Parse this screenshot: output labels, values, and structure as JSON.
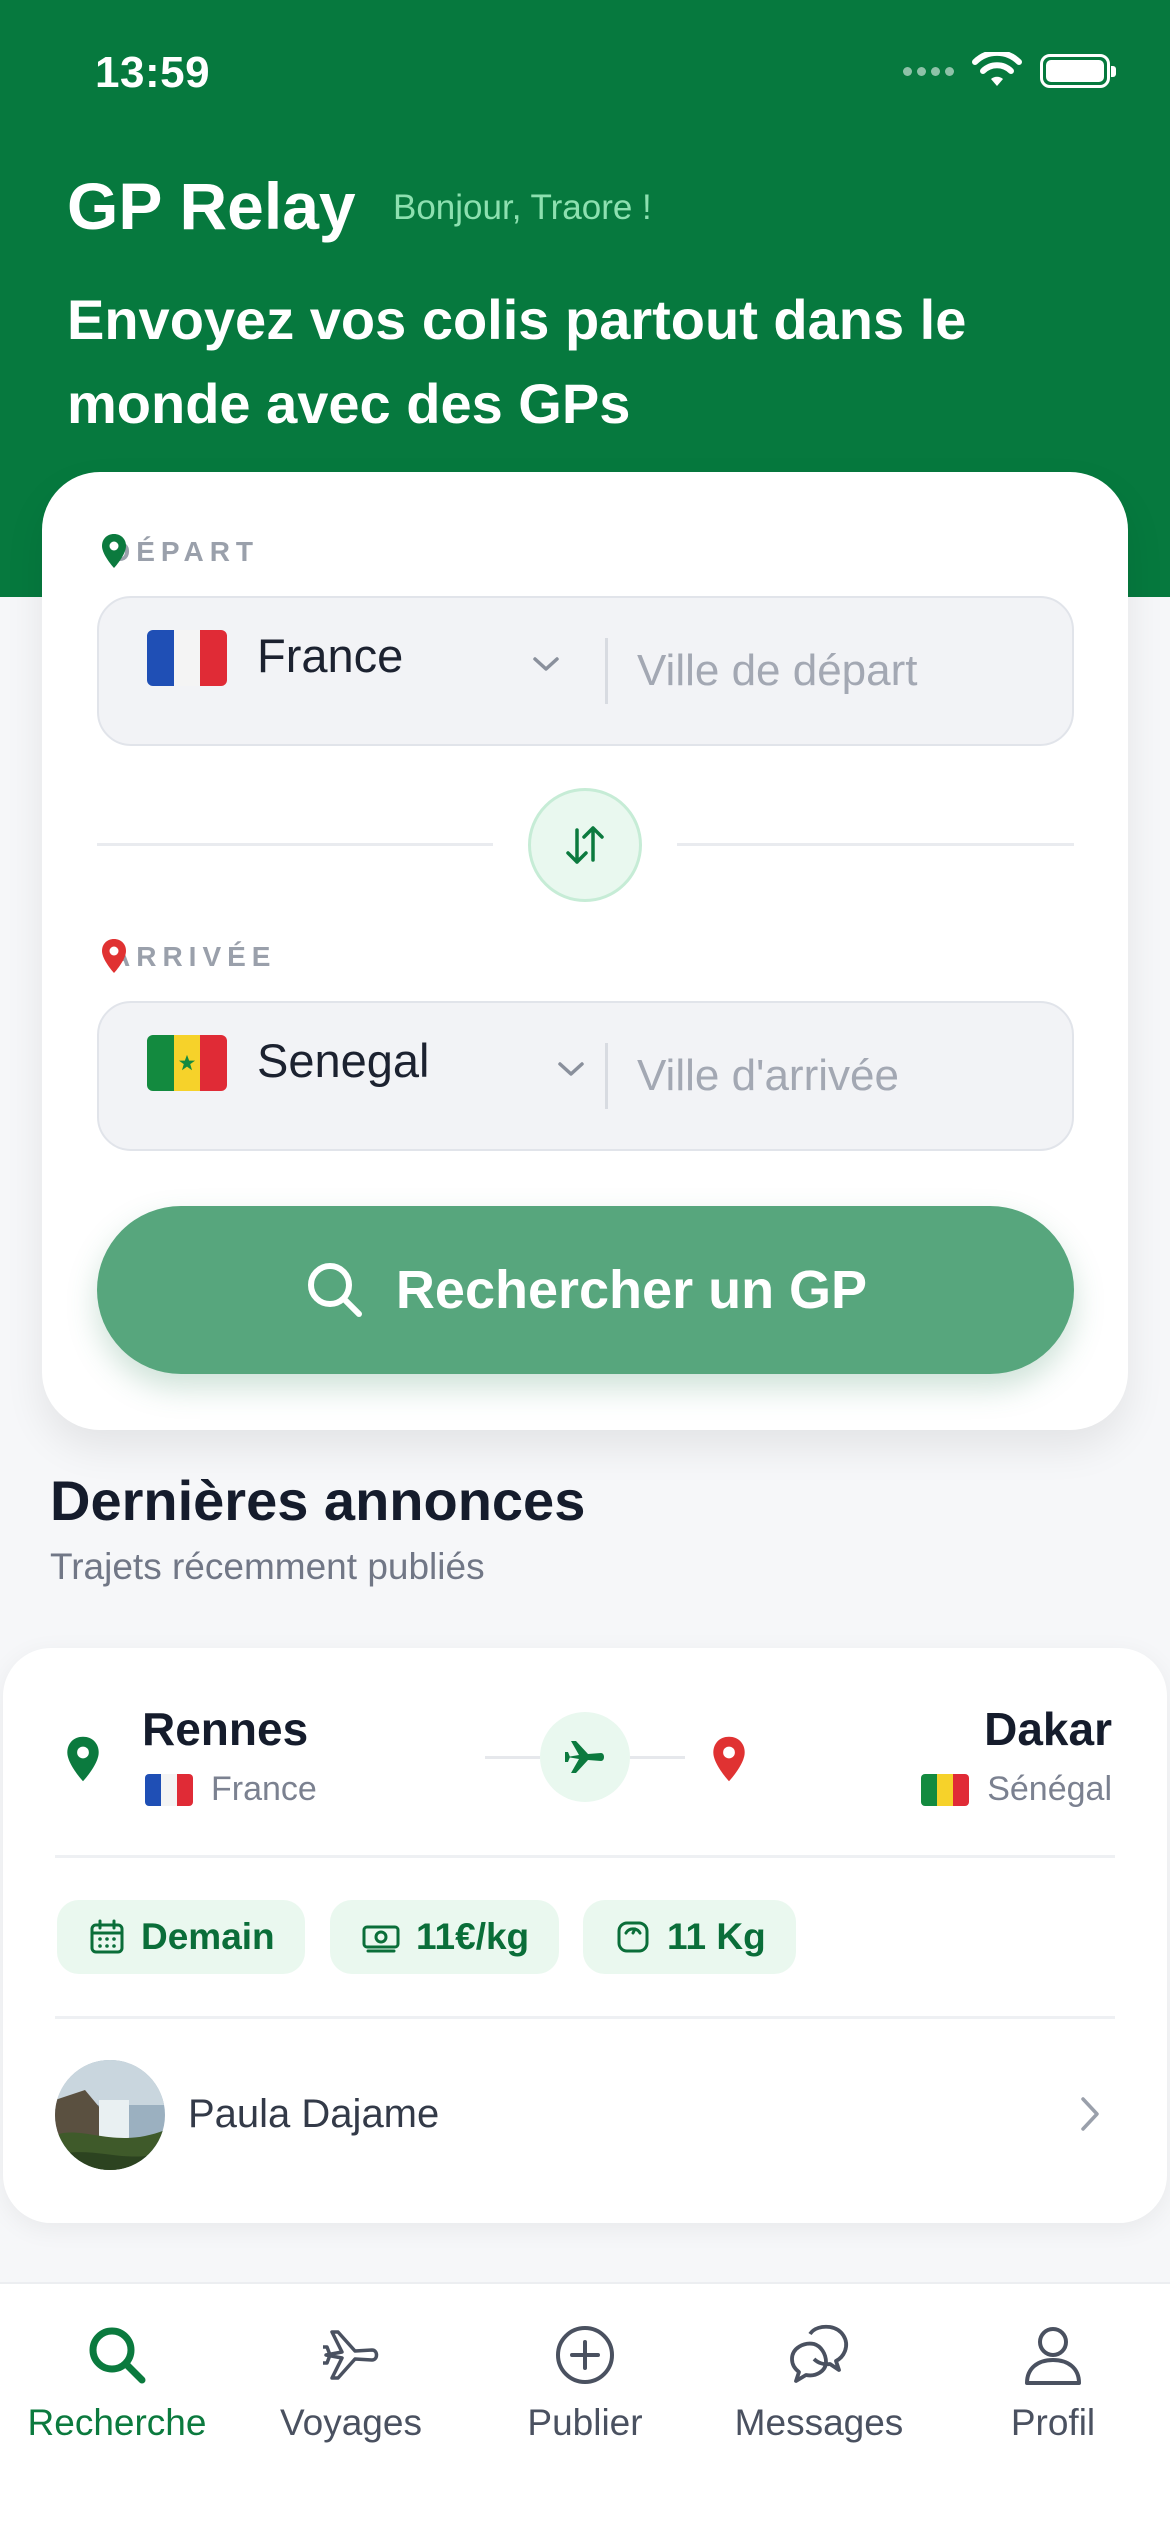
{
  "status_bar": {
    "time": "13:59"
  },
  "header": {
    "app_title": "GP Relay",
    "greeting": "Bonjour, Traore !",
    "tagline": "Envoyez vos colis partout dans le monde avec des GPs"
  },
  "search": {
    "departure": {
      "label": "DÉPART",
      "country": "France",
      "flag": "flag-france",
      "city_placeholder": "Ville de départ"
    },
    "arrival": {
      "label": "ARRIVÉE",
      "country": "Senegal",
      "flag": "flag-senegal",
      "city_placeholder": "Ville d'arrivée"
    },
    "swap_icon": "swap-arrows-icon",
    "button_label": "Rechercher un GP"
  },
  "latest": {
    "title": "Dernières annonces",
    "subtitle": "Trajets récemment publiés",
    "listings": [
      {
        "from_city": "Rennes",
        "from_country": "France",
        "to_city": "Dakar",
        "to_country": "Sénégal",
        "date": "Demain",
        "price": "11€/kg",
        "capacity": "11 Kg",
        "traveler": "Paula Dajame"
      }
    ]
  },
  "tabs": [
    {
      "label": "Recherche",
      "icon": "search-icon",
      "active": true
    },
    {
      "label": "Voyages",
      "icon": "plane-icon",
      "active": false
    },
    {
      "label": "Publier",
      "icon": "plus-circle-icon",
      "active": false
    },
    {
      "label": "Messages",
      "icon": "chat-icon",
      "active": false
    },
    {
      "label": "Profil",
      "icon": "user-icon",
      "active": false
    }
  ],
  "colors": {
    "brand_green": "#06793e",
    "button_green": "#57a67d",
    "chip_bg": "#eaf8ef",
    "pin_red": "#e03232"
  }
}
